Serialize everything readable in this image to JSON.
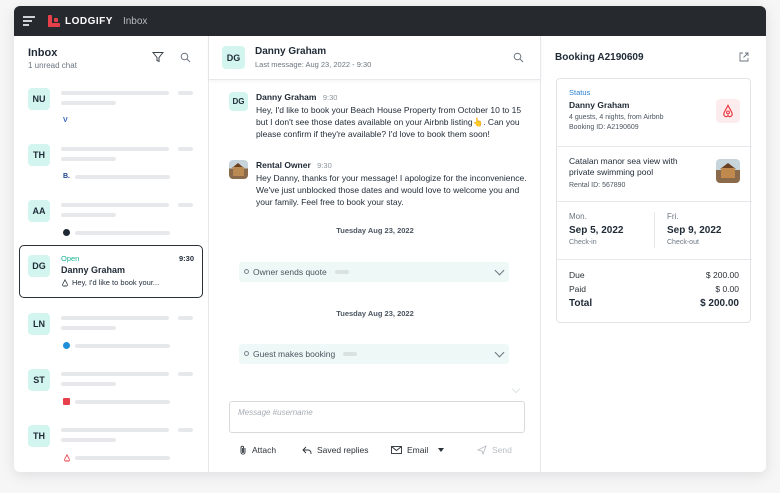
{
  "topbar": {
    "brand": "LODGIFY",
    "section": "Inbox"
  },
  "inbox": {
    "title": "Inbox",
    "subtitle": "1 unread chat",
    "chats": [
      {
        "initials": "NU",
        "channel": "vrbo"
      },
      {
        "initials": "TH",
        "channel": "booking"
      },
      {
        "initials": "AA",
        "channel": "other"
      },
      {
        "initials": "LN",
        "channel": "expedia"
      },
      {
        "initials": "ST",
        "channel": "lodgify"
      },
      {
        "initials": "TH",
        "channel": "airbnb"
      }
    ],
    "active_chat": {
      "initials": "DG",
      "status": "Open",
      "time": "9:30",
      "name": "Danny Graham",
      "preview": "Hey, I'd like to book your..."
    }
  },
  "conversation": {
    "header_initials": "DG",
    "header_name": "Danny Graham",
    "header_sub": "Last message: Aug 23, 2022 - 9:30",
    "messages": [
      {
        "initials": "DG",
        "name": "Danny Graham",
        "time": "9:30",
        "text": "Hey, I'd like to book your Beach House Property from October 10 to 15 but I don't see those dates available on your Airbnb listing👆. Can you please confirm if they're available? I'd love to book them soon!"
      },
      {
        "name": "Rental Owner",
        "time": "9:30",
        "text": "Hey Danny, thanks for your message! I apologize for the inconvenience. We've just unblocked those dates and would love to welcome you and your family. Feel free to book your stay."
      }
    ],
    "date_sep_1": "Tuesday Aug 23, 2022",
    "event_1": "Owner sends quote",
    "date_sep_2": "Tuesday Aug 23, 2022",
    "event_2": "Guest makes booking",
    "compose_placeholder": "Message #username",
    "tools": {
      "attach": "Attach",
      "saved": "Saved replies",
      "email": "Email",
      "send": "Send"
    }
  },
  "booking": {
    "title": "Booking A2190609",
    "status_label": "Status",
    "guest_name": "Danny Graham",
    "guest_details": "4 guests, 4 nights, from Airbnb",
    "booking_id": "Booking ID: A2190609",
    "rental_name": "Catalan manor sea view with private swimming pool",
    "rental_id": "Rental ID: 567890",
    "checkin_day": "Mon.",
    "checkin_date": "Sep 5, 2022",
    "checkin_label": "Check-in",
    "checkout_day": "Fri.",
    "checkout_date": "Sep 9, 2022",
    "checkout_label": "Check-out",
    "due_label": "Due",
    "due_value": "$ 200.00",
    "paid_label": "Paid",
    "paid_value": "$ 0.00",
    "total_label": "Total",
    "total_value": "$ 200.00"
  },
  "colors": {
    "accent": "#19b394",
    "avatar_bg": "#d3f5ef",
    "topbar": "#26292d",
    "brand_red": "#e8404a"
  }
}
